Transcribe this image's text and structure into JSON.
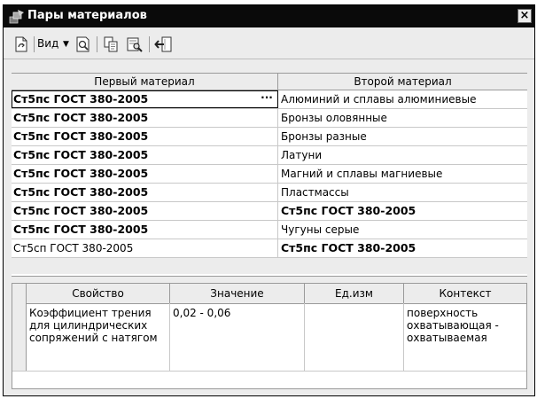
{
  "window": {
    "title": "Пары материалов",
    "close_label": "×"
  },
  "toolbar": {
    "view_label": "Вид"
  },
  "pairs_table": {
    "headers": [
      "Первый материал",
      "Второй материал"
    ],
    "rows": [
      {
        "first": "Ст5пс ГОСТ 380-2005",
        "second": "Алюминий и сплавы алюминиевые",
        "first_bold": true,
        "second_bold": false
      },
      {
        "first": "Ст5пс ГОСТ 380-2005",
        "second": "Бронзы оловянные",
        "first_bold": true,
        "second_bold": false
      },
      {
        "first": "Ст5пс ГОСТ 380-2005",
        "second": "Бронзы разные",
        "first_bold": true,
        "second_bold": false
      },
      {
        "first": "Ст5пс ГОСТ 380-2005",
        "second": "Латуни",
        "first_bold": true,
        "second_bold": false
      },
      {
        "first": "Ст5пс ГОСТ 380-2005",
        "second": "Магний и сплавы магниевые",
        "first_bold": true,
        "second_bold": false
      },
      {
        "first": "Ст5пс ГОСТ 380-2005",
        "second": "Пластмассы",
        "first_bold": true,
        "second_bold": false
      },
      {
        "first": "Ст5пс ГОСТ 380-2005",
        "second": "Ст5пс ГОСТ 380-2005",
        "first_bold": true,
        "second_bold": true
      },
      {
        "first": "Ст5пс ГОСТ 380-2005",
        "second": "Чугуны серые",
        "first_bold": true,
        "second_bold": false
      },
      {
        "first": "Ст5сп ГОСТ 380-2005",
        "second": "Ст5пс ГОСТ 380-2005",
        "first_bold": false,
        "second_bold": true
      }
    ],
    "ellipsis_label": "···"
  },
  "properties_table": {
    "headers": [
      "Свойство",
      "Значение",
      "Ед.изм",
      "Контекст"
    ],
    "rows": [
      {
        "property": "Коэффициент трения для цилиндрических сопряжений с натягом",
        "value": "0,02 - 0,06",
        "unit": "",
        "context": "поверхность охватывающая - охватываемая"
      }
    ]
  }
}
